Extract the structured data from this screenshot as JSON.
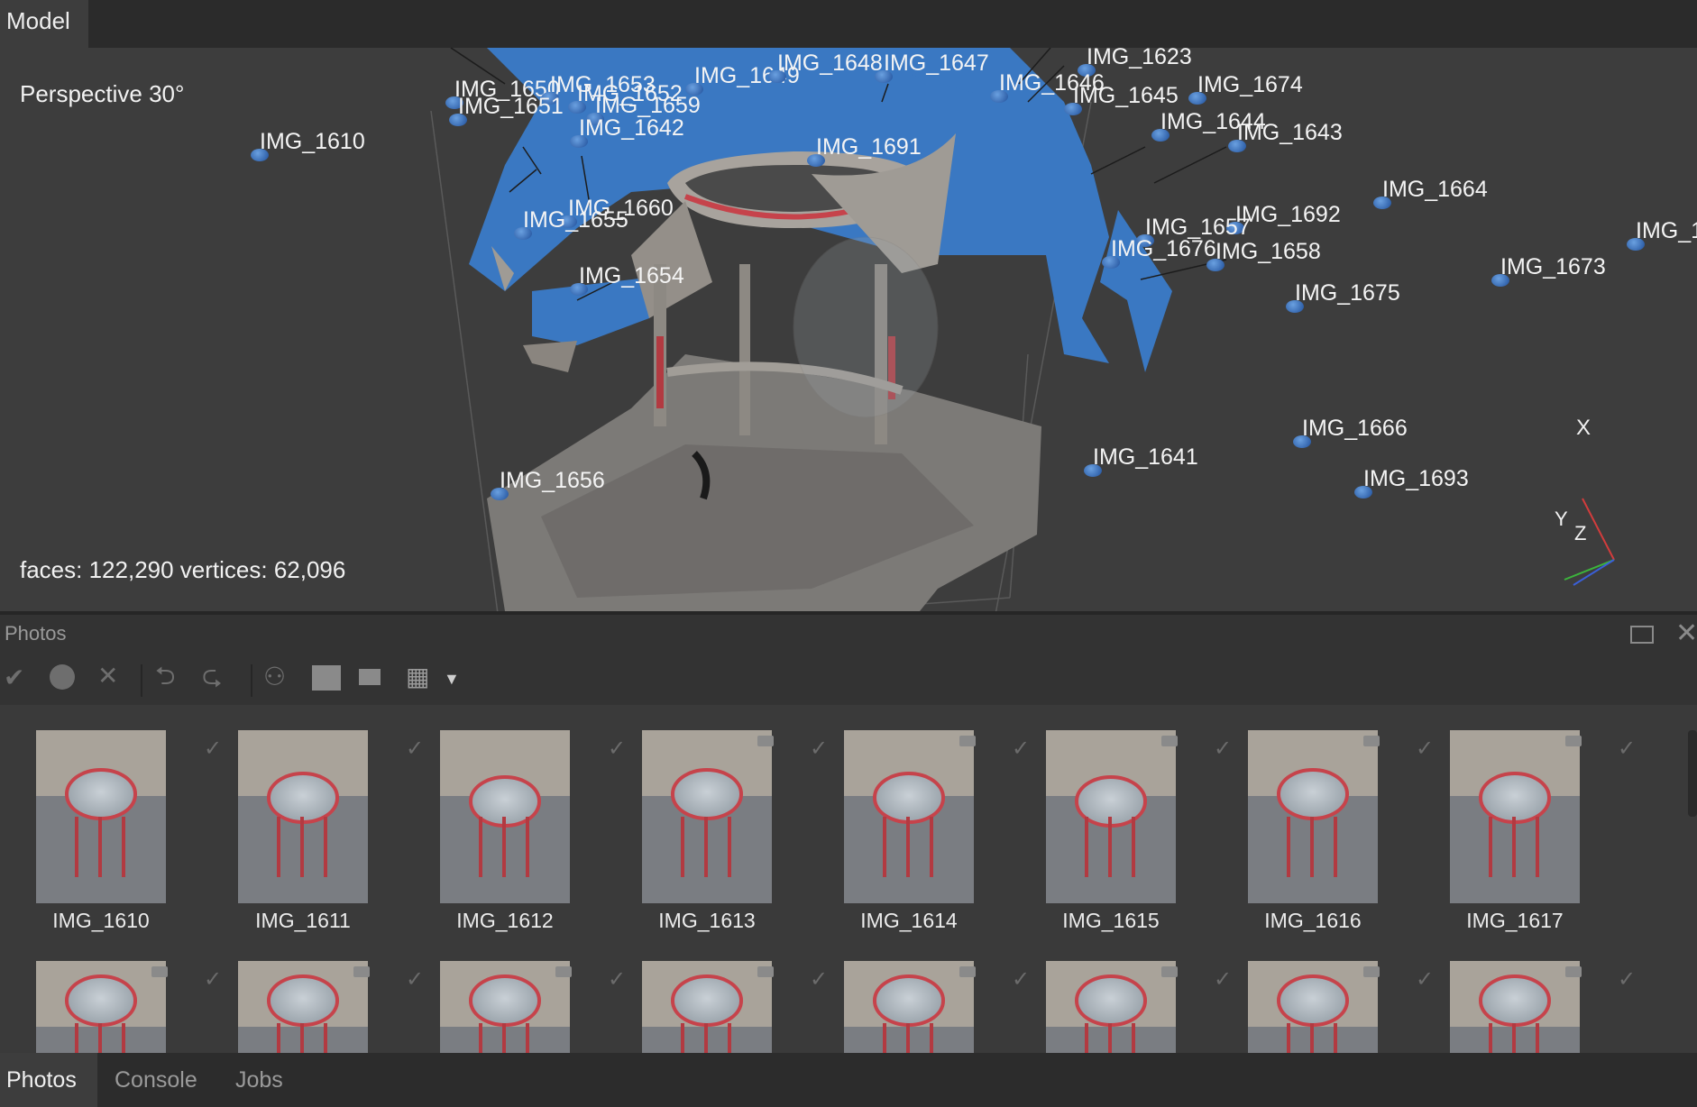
{
  "top_tab": "Model",
  "viewport": {
    "projection": "Perspective 30°",
    "stats": "faces: 122,290 vertices: 62,096",
    "axes": {
      "x": "X",
      "y": "Y",
      "z": "Z"
    },
    "cameras": [
      "IMG_1610",
      "IMG_1650",
      "IMG_1653",
      "IMG_1652",
      "IMG_1651",
      "IMG_1659",
      "IMG_1642",
      "IMG_1649",
      "IMG_1648",
      "IMG_1647",
      "IMG_1623",
      "IMG_1646",
      "IMG_1645",
      "IMG_1674",
      "IMG_1644",
      "IMG_1643",
      "IMG_1691",
      "IMG_1660",
      "IMG_1655",
      "IMG_1654",
      "IMG_1664",
      "IMG_1692",
      "IMG_1657",
      "IMG_1676",
      "IMG_1658",
      "IMG_1675",
      "IMG_1673",
      "IMG_1",
      "IMG_1666",
      "IMG_1641",
      "IMG_1693",
      "IMG_1656"
    ]
  },
  "photos_panel": {
    "title": "Photos",
    "toolbar_icons": [
      "check-circle-icon",
      "minus-circle-icon",
      "close-icon",
      "rotate-left-icon",
      "rotate-right-icon",
      "binoculars-icon",
      "mask-icon",
      "overlap-icon",
      "grid-view-icon",
      "dropdown-icon"
    ],
    "row1": [
      "IMG_1610",
      "IMG_1611",
      "IMG_1612",
      "IMG_1613",
      "IMG_1614",
      "IMG_1615",
      "IMG_1616",
      "IMG_1617"
    ]
  },
  "bottom_tabs": [
    "Photos",
    "Console",
    "Jobs"
  ],
  "colors": {
    "accent_blue": "#3a78c2",
    "stool_red": "#c6434b",
    "bg": "#3d3d3d"
  }
}
